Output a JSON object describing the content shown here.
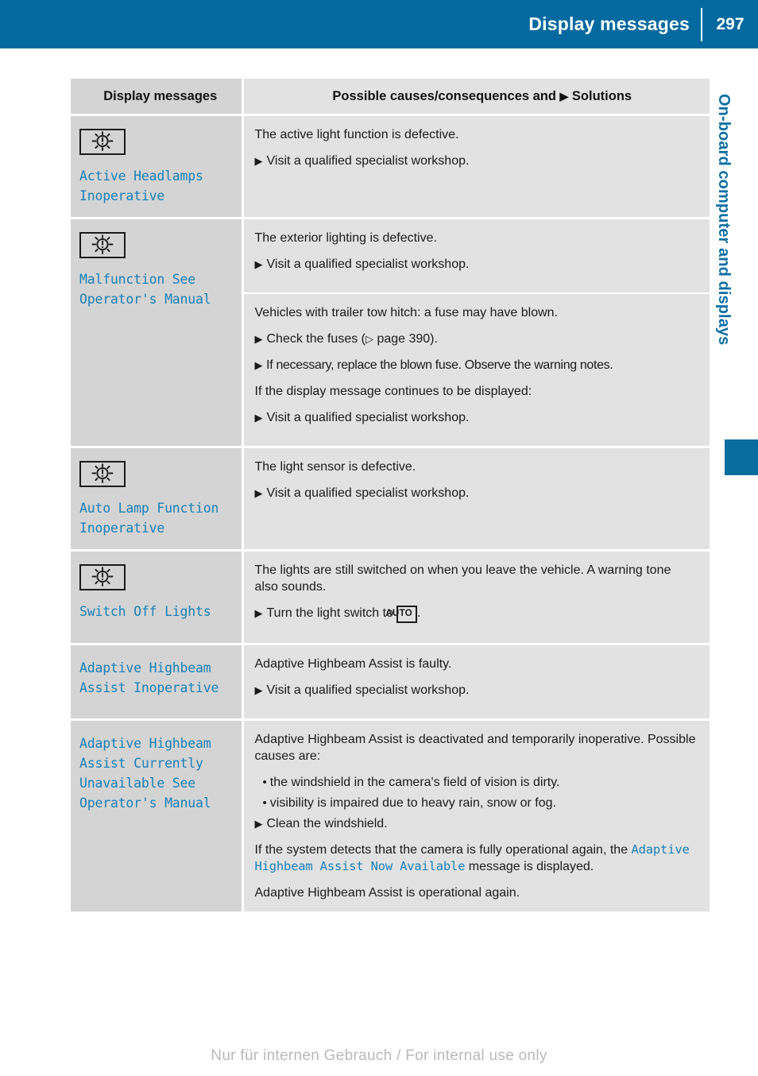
{
  "header": {
    "title": "Display messages",
    "page_number": "297"
  },
  "side_tab": {
    "label": "On-board computer and displays",
    "accent_color": "#0a6d9f"
  },
  "colors": {
    "header_blue": "#026a9e",
    "message_blue": "#1b80b7",
    "left_column_bg": "#d4d4d4",
    "right_column_bg": "#e2e2e2"
  },
  "table": {
    "columns": [
      {
        "label": "Display messages"
      },
      {
        "label_before": "Possible causes/consequences and",
        "triangle": "▶",
        "label_after": "Solutions"
      }
    ],
    "rows": [
      {
        "icon": "lamp-warning-icon",
        "message": "Active Headlamps\nInoperative",
        "blocks": [
          {
            "kind": "para",
            "text": "The active light function is defective."
          },
          {
            "kind": "step",
            "text": "Visit a qualified specialist workshop."
          }
        ]
      },
      {
        "icon": "lamp-warning-icon",
        "message": "Malfunction See\nOperator's Manual",
        "sub_blocks": [
          [
            {
              "kind": "para",
              "text": "The exterior lighting is defective."
            },
            {
              "kind": "step",
              "text": "Visit a qualified specialist workshop."
            }
          ],
          [
            {
              "kind": "para",
              "text": "Vehicles with trailer tow hitch: a fuse may have blown."
            },
            {
              "kind": "step_ref",
              "text_before": "Check the fuses (",
              "ref_triangle": "▷",
              "ref_text": " page 390).",
              "text_after": ""
            },
            {
              "kind": "step_tight",
              "text": "If necessary, replace the blown fuse. Observe the warning notes."
            },
            {
              "kind": "para",
              "text": "If the display message continues to be displayed:"
            },
            {
              "kind": "step",
              "text": "Visit a qualified specialist workshop."
            }
          ]
        ]
      },
      {
        "icon": "lamp-warning-icon",
        "message": "Auto Lamp Function\nInoperative",
        "blocks": [
          {
            "kind": "para",
            "text": "The light sensor is defective."
          },
          {
            "kind": "step",
            "text": "Visit a qualified specialist workshop."
          }
        ]
      },
      {
        "icon": "lamp-warning-icon",
        "message": "Switch Off Lights",
        "blocks": [
          {
            "kind": "para",
            "text": "The lights are still switched on when you leave the vehicle. A warning tone also sounds."
          },
          {
            "kind": "step_auto",
            "text_before": "Turn the light switch to ",
            "badge": "AUTO",
            "text_after": "."
          }
        ]
      },
      {
        "icon": null,
        "message": "Adaptive Highbeam\nAssist Inoperative",
        "blocks": [
          {
            "kind": "para",
            "text": "Adaptive Highbeam Assist is faulty."
          },
          {
            "kind": "step",
            "text": "Visit a qualified specialist workshop."
          }
        ]
      },
      {
        "icon": null,
        "message": "Adaptive Highbeam\nAssist Currently\nUnavailable See\nOperator's Manual",
        "blocks": [
          {
            "kind": "para",
            "text": "Adaptive Highbeam Assist is deactivated and temporarily inoperative. Possible causes are:"
          },
          {
            "kind": "bullet",
            "text": "the windshield in the camera's field of vision is dirty."
          },
          {
            "kind": "bullet",
            "text": "visibility is impaired due to heavy rain, snow or fog."
          },
          {
            "kind": "step",
            "text": "Clean the windshield."
          },
          {
            "kind": "para_code",
            "text_before": "If the system detects that the camera is fully operational again, the ",
            "code": "Adaptive Highbeam Assist Now Available",
            "text_after": " message is displayed."
          },
          {
            "kind": "para",
            "text": "Adaptive Highbeam Assist is operational again."
          }
        ]
      }
    ]
  },
  "footer": {
    "watermark": "Nur für internen Gebrauch / For internal use only"
  }
}
